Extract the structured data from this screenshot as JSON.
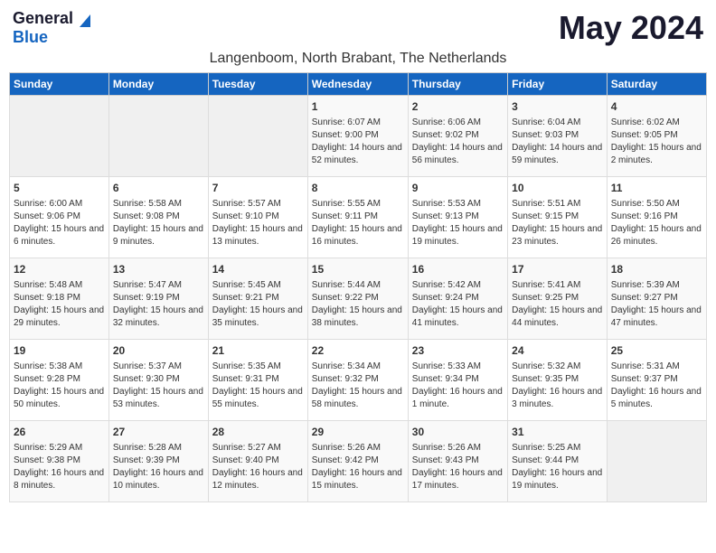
{
  "header": {
    "logo_general": "General",
    "logo_blue": "Blue",
    "month_title": "May 2024",
    "subtitle": "Langenboom, North Brabant, The Netherlands"
  },
  "weekdays": [
    "Sunday",
    "Monday",
    "Tuesday",
    "Wednesday",
    "Thursday",
    "Friday",
    "Saturday"
  ],
  "weeks": [
    [
      {
        "day": "",
        "info": ""
      },
      {
        "day": "",
        "info": ""
      },
      {
        "day": "",
        "info": ""
      },
      {
        "day": "1",
        "info": "Sunrise: 6:07 AM\nSunset: 9:00 PM\nDaylight: 14 hours and 52 minutes."
      },
      {
        "day": "2",
        "info": "Sunrise: 6:06 AM\nSunset: 9:02 PM\nDaylight: 14 hours and 56 minutes."
      },
      {
        "day": "3",
        "info": "Sunrise: 6:04 AM\nSunset: 9:03 PM\nDaylight: 14 hours and 59 minutes."
      },
      {
        "day": "4",
        "info": "Sunrise: 6:02 AM\nSunset: 9:05 PM\nDaylight: 15 hours and 2 minutes."
      }
    ],
    [
      {
        "day": "5",
        "info": "Sunrise: 6:00 AM\nSunset: 9:06 PM\nDaylight: 15 hours and 6 minutes."
      },
      {
        "day": "6",
        "info": "Sunrise: 5:58 AM\nSunset: 9:08 PM\nDaylight: 15 hours and 9 minutes."
      },
      {
        "day": "7",
        "info": "Sunrise: 5:57 AM\nSunset: 9:10 PM\nDaylight: 15 hours and 13 minutes."
      },
      {
        "day": "8",
        "info": "Sunrise: 5:55 AM\nSunset: 9:11 PM\nDaylight: 15 hours and 16 minutes."
      },
      {
        "day": "9",
        "info": "Sunrise: 5:53 AM\nSunset: 9:13 PM\nDaylight: 15 hours and 19 minutes."
      },
      {
        "day": "10",
        "info": "Sunrise: 5:51 AM\nSunset: 9:15 PM\nDaylight: 15 hours and 23 minutes."
      },
      {
        "day": "11",
        "info": "Sunrise: 5:50 AM\nSunset: 9:16 PM\nDaylight: 15 hours and 26 minutes."
      }
    ],
    [
      {
        "day": "12",
        "info": "Sunrise: 5:48 AM\nSunset: 9:18 PM\nDaylight: 15 hours and 29 minutes."
      },
      {
        "day": "13",
        "info": "Sunrise: 5:47 AM\nSunset: 9:19 PM\nDaylight: 15 hours and 32 minutes."
      },
      {
        "day": "14",
        "info": "Sunrise: 5:45 AM\nSunset: 9:21 PM\nDaylight: 15 hours and 35 minutes."
      },
      {
        "day": "15",
        "info": "Sunrise: 5:44 AM\nSunset: 9:22 PM\nDaylight: 15 hours and 38 minutes."
      },
      {
        "day": "16",
        "info": "Sunrise: 5:42 AM\nSunset: 9:24 PM\nDaylight: 15 hours and 41 minutes."
      },
      {
        "day": "17",
        "info": "Sunrise: 5:41 AM\nSunset: 9:25 PM\nDaylight: 15 hours and 44 minutes."
      },
      {
        "day": "18",
        "info": "Sunrise: 5:39 AM\nSunset: 9:27 PM\nDaylight: 15 hours and 47 minutes."
      }
    ],
    [
      {
        "day": "19",
        "info": "Sunrise: 5:38 AM\nSunset: 9:28 PM\nDaylight: 15 hours and 50 minutes."
      },
      {
        "day": "20",
        "info": "Sunrise: 5:37 AM\nSunset: 9:30 PM\nDaylight: 15 hours and 53 minutes."
      },
      {
        "day": "21",
        "info": "Sunrise: 5:35 AM\nSunset: 9:31 PM\nDaylight: 15 hours and 55 minutes."
      },
      {
        "day": "22",
        "info": "Sunrise: 5:34 AM\nSunset: 9:32 PM\nDaylight: 15 hours and 58 minutes."
      },
      {
        "day": "23",
        "info": "Sunrise: 5:33 AM\nSunset: 9:34 PM\nDaylight: 16 hours and 1 minute."
      },
      {
        "day": "24",
        "info": "Sunrise: 5:32 AM\nSunset: 9:35 PM\nDaylight: 16 hours and 3 minutes."
      },
      {
        "day": "25",
        "info": "Sunrise: 5:31 AM\nSunset: 9:37 PM\nDaylight: 16 hours and 5 minutes."
      }
    ],
    [
      {
        "day": "26",
        "info": "Sunrise: 5:29 AM\nSunset: 9:38 PM\nDaylight: 16 hours and 8 minutes."
      },
      {
        "day": "27",
        "info": "Sunrise: 5:28 AM\nSunset: 9:39 PM\nDaylight: 16 hours and 10 minutes."
      },
      {
        "day": "28",
        "info": "Sunrise: 5:27 AM\nSunset: 9:40 PM\nDaylight: 16 hours and 12 minutes."
      },
      {
        "day": "29",
        "info": "Sunrise: 5:26 AM\nSunset: 9:42 PM\nDaylight: 16 hours and 15 minutes."
      },
      {
        "day": "30",
        "info": "Sunrise: 5:26 AM\nSunset: 9:43 PM\nDaylight: 16 hours and 17 minutes."
      },
      {
        "day": "31",
        "info": "Sunrise: 5:25 AM\nSunset: 9:44 PM\nDaylight: 16 hours and 19 minutes."
      },
      {
        "day": "",
        "info": ""
      }
    ]
  ]
}
